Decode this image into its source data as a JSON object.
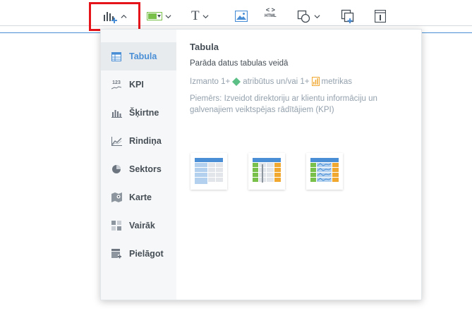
{
  "toolbar": {
    "buttons": [
      {
        "name": "insights-button",
        "icon": "bar-chart-plus-icon"
      },
      {
        "name": "filter-button",
        "icon": "filter-icon"
      },
      {
        "name": "text-button",
        "icon": "text-icon",
        "glyph": "T"
      },
      {
        "name": "image-button",
        "icon": "image-icon"
      },
      {
        "name": "html-button",
        "icon": "html-icon",
        "glyph": "HTML",
        "code_glyph": "< >"
      },
      {
        "name": "shapes-button",
        "icon": "shapes-icon"
      },
      {
        "name": "duplicate-button",
        "icon": "duplicate-icon"
      },
      {
        "name": "info-button",
        "icon": "info-icon",
        "glyph": "i"
      }
    ]
  },
  "sidebar": {
    "items": [
      {
        "label": "Tabula",
        "icon": "table-icon",
        "active": true
      },
      {
        "label": "KPI",
        "icon": "kpi-icon",
        "glyph": "123"
      },
      {
        "label": "Šķirtne",
        "icon": "column-chart-icon"
      },
      {
        "label": "Rindiņa",
        "icon": "line-chart-icon"
      },
      {
        "label": "Sektors",
        "icon": "pie-chart-icon"
      },
      {
        "label": "Karte",
        "icon": "map-icon"
      },
      {
        "label": "Vairāk",
        "icon": "more-icon"
      },
      {
        "label": "Pielāgot",
        "icon": "custom-icon"
      }
    ]
  },
  "detail": {
    "title": "Tabula",
    "subtitle": "Parāda datus tabulas veidā",
    "requires_prefix": "Izmanto 1+",
    "requires_attributes": "atribūtus un/vai 1+",
    "requires_metrics": "metrikas",
    "example": "Piemērs: Izveidot direktoriju ar klientu informāciju un galvenajiem veiktspējas rādītājiem (KPI)",
    "thumbnails": [
      "table-variant-basic",
      "table-variant-grouped",
      "table-variant-sparkline"
    ]
  },
  "colors": {
    "accent": "#4a8fd6",
    "highlight": "#e5141a",
    "attribute": "#5cbf85",
    "metric": "#f0a830",
    "filter_green": "#78c04a"
  }
}
